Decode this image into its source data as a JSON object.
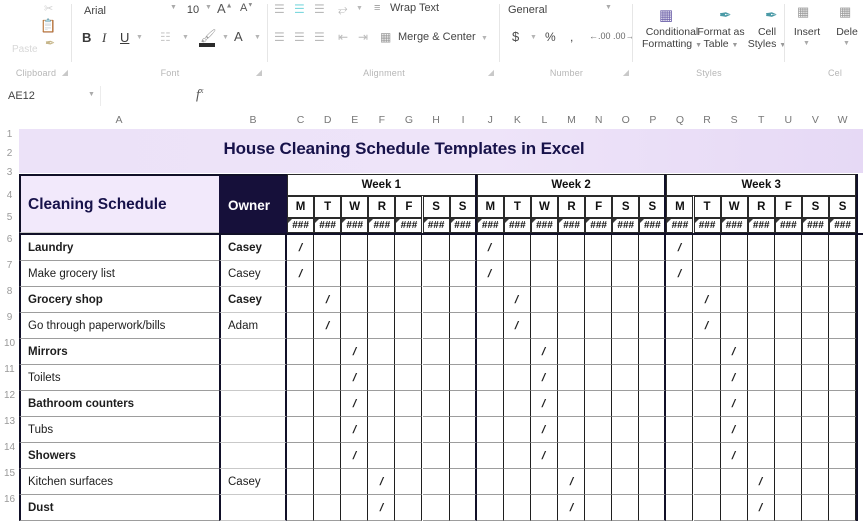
{
  "ribbon": {
    "groups": [
      {
        "name": "Clipboard",
        "label": "Clipboard"
      },
      {
        "name": "Font",
        "label": "Font"
      },
      {
        "name": "Alignment",
        "label": "Alignment"
      },
      {
        "name": "Number",
        "label": "Number"
      },
      {
        "name": "Styles",
        "label": "Styles"
      },
      {
        "name": "Cells",
        "label": "Cel"
      }
    ],
    "clipboard": {
      "paste_label": "Paste"
    },
    "font": {
      "family_value": "Arial",
      "size_value": "10",
      "grow_font": "A",
      "shrink_font": "A",
      "bold": "B",
      "italic": "I",
      "underline": "U",
      "borders_icon": "borders-icon",
      "fill_color": "A",
      "font_color": "A"
    },
    "alignment": {
      "wrap_text": "Wrap Text",
      "merge_center": "Merge & Center",
      "orientation_icon": "orientation-icon"
    },
    "number": {
      "format_value": "General",
      "currency": "$",
      "percent": "%",
      "comma": ",",
      "inc_decimal": ".00",
      "dec_decimal": ".00"
    },
    "styles": {
      "conditional_formatting": "Conditional\nFormatting",
      "conditional_line1": "Conditional",
      "conditional_line2": "Formatting",
      "format_as_table_line1": "Format as",
      "format_as_table_line2": "Table",
      "cell_styles_line1": "Cell",
      "cell_styles_line2": "Styles"
    },
    "cells": {
      "insert": "Insert",
      "delete": "Dele"
    }
  },
  "formula_bar": {
    "name_box": "AE12",
    "fx_label": "fx",
    "formula_value": ""
  },
  "grid": {
    "columns": [
      "A",
      "B",
      "C",
      "D",
      "E",
      "F",
      "G",
      "H",
      "I",
      "J",
      "K",
      "L",
      "M",
      "N",
      "O",
      "P",
      "Q",
      "R",
      "S",
      "T",
      "U",
      "V",
      "W"
    ],
    "rows": [
      "1",
      "2",
      "3",
      "4",
      "5",
      "6",
      "7",
      "8",
      "9",
      "10",
      "11",
      "12",
      "13",
      "14",
      "15",
      "16"
    ]
  },
  "sheet": {
    "title": "House Cleaning Schedule Templates in Excel",
    "header_name": "Cleaning Schedule",
    "owner_header": "Owner",
    "weeks": [
      {
        "label": "Week 1",
        "days": [
          "M",
          "T",
          "W",
          "R",
          "F",
          "S",
          "S"
        ]
      },
      {
        "label": "Week 2",
        "days": [
          "M",
          "T",
          "W",
          "R",
          "F",
          "S",
          "S"
        ]
      },
      {
        "label": "Week 3",
        "days": [
          "M",
          "T",
          "W",
          "R",
          "F",
          "S",
          "S"
        ]
      }
    ],
    "date_placeholder": "###",
    "check_mark": "/",
    "tasks": [
      {
        "row": "6",
        "task": "Laundry",
        "owner": "Casey",
        "bold": true,
        "checks": [
          0,
          0,
          0
        ]
      },
      {
        "row": "7",
        "task": "Make grocery list",
        "owner": "Casey",
        "bold": false,
        "checks": [
          0,
          0,
          0
        ]
      },
      {
        "row": "8",
        "task": "Grocery shop",
        "owner": "Casey",
        "bold": true,
        "checks": [
          1,
          1,
          1
        ]
      },
      {
        "row": "9",
        "task": "Go through paperwork/bills",
        "owner": "Adam",
        "bold": false,
        "checks": [
          1,
          1,
          1
        ]
      },
      {
        "row": "10",
        "task": "Mirrors",
        "owner": "",
        "bold": true,
        "checks": [
          2,
          2,
          2
        ]
      },
      {
        "row": "11",
        "task": "Toilets",
        "owner": "",
        "bold": false,
        "checks": [
          2,
          2,
          2
        ]
      },
      {
        "row": "12",
        "task": "Bathroom counters",
        "owner": "",
        "bold": true,
        "checks": [
          2,
          2,
          2
        ]
      },
      {
        "row": "13",
        "task": "Tubs",
        "owner": "",
        "bold": false,
        "checks": [
          2,
          2,
          2
        ]
      },
      {
        "row": "14",
        "task": "Showers",
        "owner": "",
        "bold": true,
        "checks": [
          2,
          2,
          2
        ]
      },
      {
        "row": "15",
        "task": "Kitchen surfaces",
        "owner": "Casey",
        "bold": false,
        "checks": [
          3,
          3,
          3
        ]
      },
      {
        "row": "16",
        "task": "Dust",
        "owner": "",
        "bold": true,
        "checks": [
          3,
          3,
          3
        ]
      }
    ]
  },
  "colors": {
    "title_bg": "#ece2f8",
    "title_text": "#17124a",
    "owner_bg": "#16103a",
    "name_bg": "#f2e9fb",
    "grid_line": "#9d9d9d",
    "border_dark": "#111028"
  }
}
